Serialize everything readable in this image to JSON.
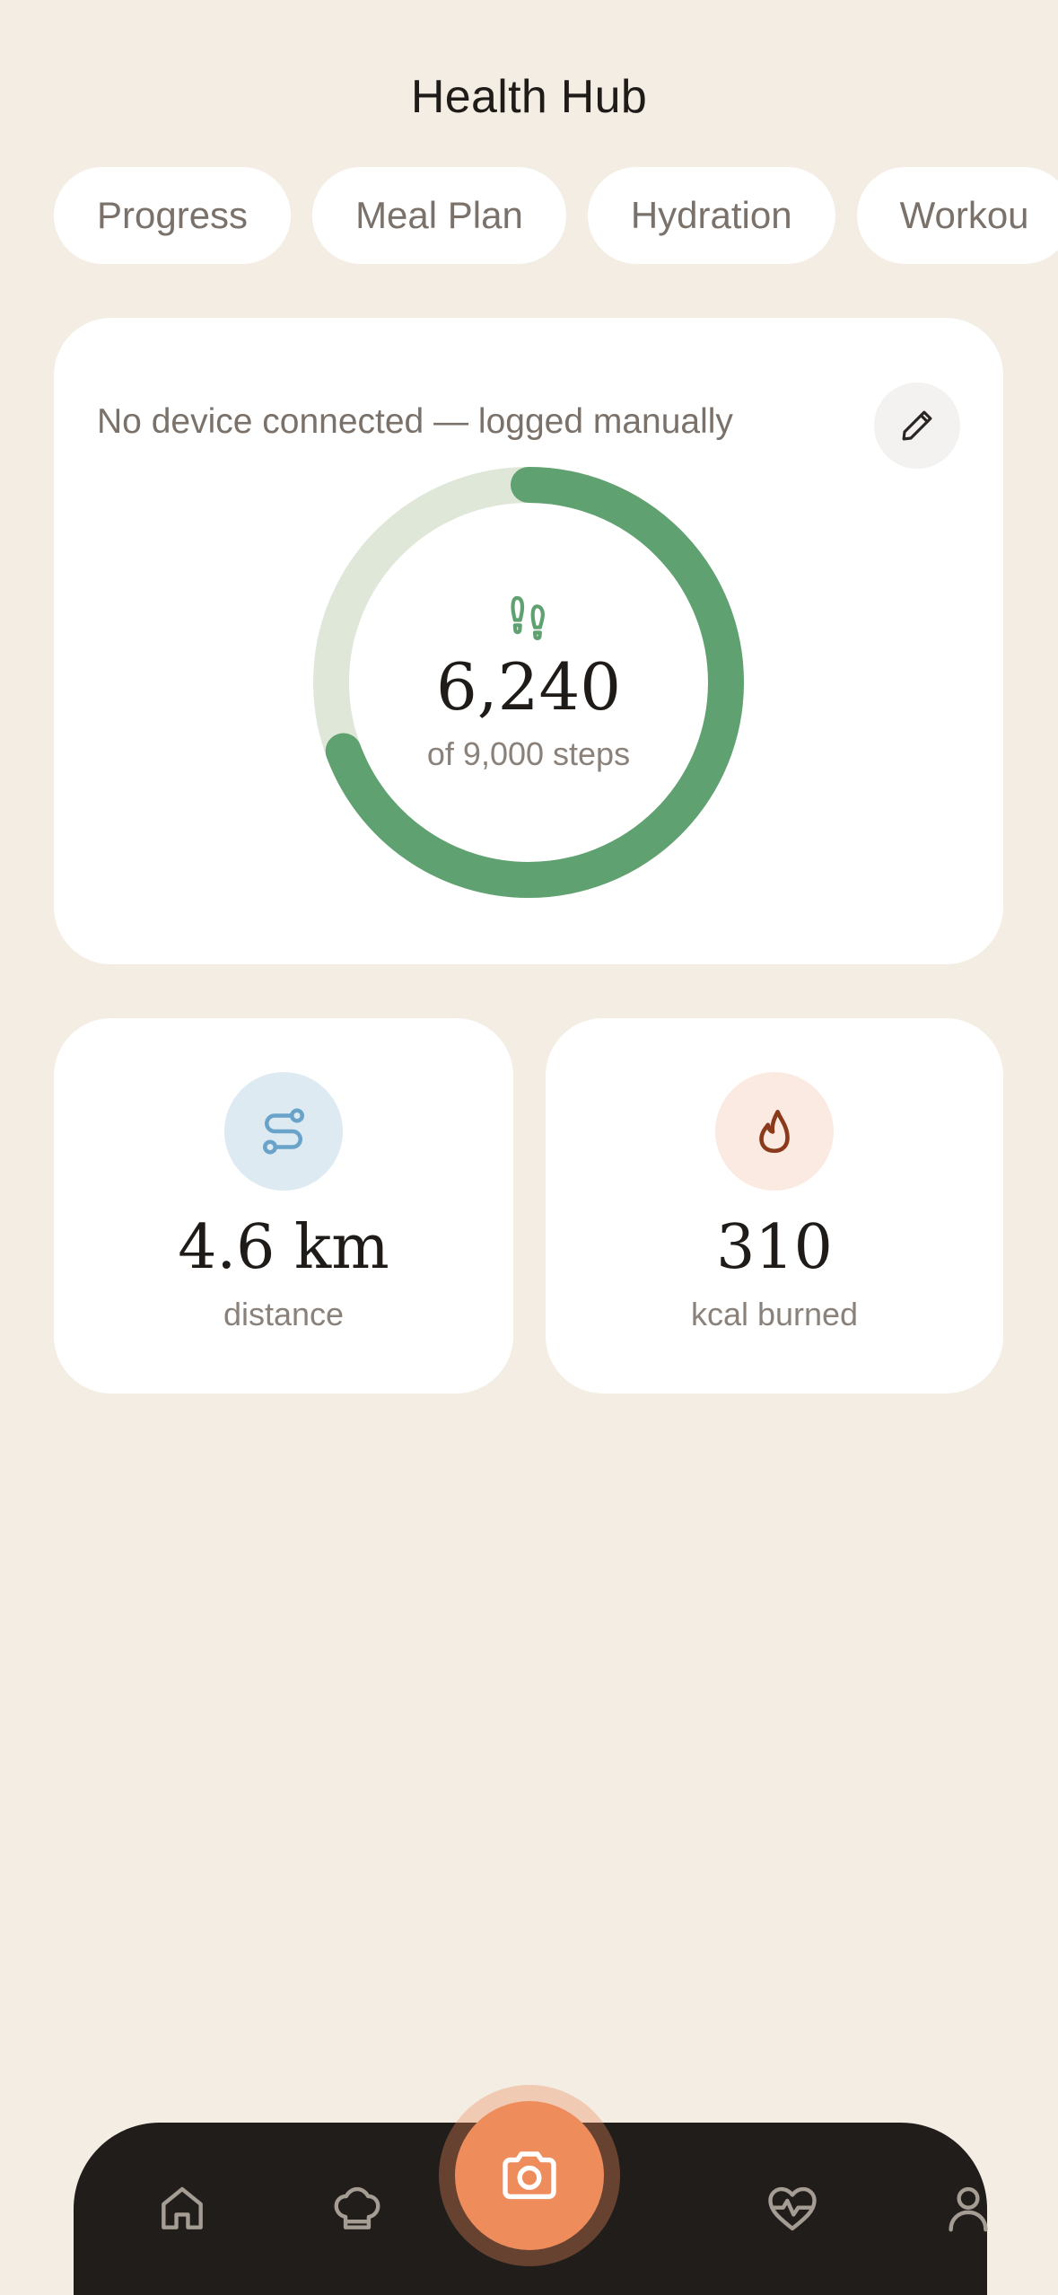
{
  "header": {
    "title": "Health Hub"
  },
  "tabs": [
    {
      "label": "Progress"
    },
    {
      "label": "Meal Plan"
    },
    {
      "label": "Hydration"
    },
    {
      "label": "Workou"
    }
  ],
  "steps_card": {
    "device_note": "No device connected — logged manually",
    "edit_icon": "pencil-icon",
    "steps_icon": "footprints-icon",
    "steps_value": "6,240",
    "steps_goal_text": "of 9,000 steps",
    "progress_fraction": 0.6933,
    "colors": {
      "progress": "#5FA170",
      "track": "#DFE8D8"
    }
  },
  "stats": [
    {
      "icon": "route-icon",
      "value": "4.6 km",
      "label": "distance",
      "icon_bg": "#DDEAF1",
      "icon_color": "#6AA3C9"
    },
    {
      "icon": "flame-icon",
      "value": "310",
      "label": "kcal burned",
      "icon_bg": "#FBEAE2",
      "icon_color": "#8A3A1A"
    }
  ],
  "bottom_nav": {
    "items": [
      {
        "icon": "home-icon"
      },
      {
        "icon": "chef-hat-icon"
      },
      {
        "icon": "camera-icon"
      },
      {
        "icon": "heart-pulse-icon"
      },
      {
        "icon": "user-icon"
      }
    ],
    "accent": "#EE8C5C"
  }
}
